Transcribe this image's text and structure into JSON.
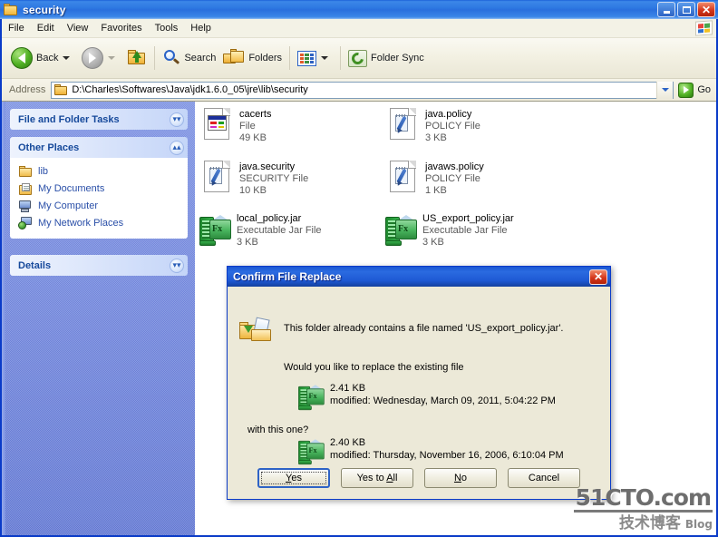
{
  "window": {
    "title": "security",
    "icon": "folder-icon",
    "buttons": {
      "minimize": "minimize",
      "maximize": "maximize",
      "close": "close"
    }
  },
  "menubar": {
    "items": [
      "File",
      "Edit",
      "View",
      "Favorites",
      "Tools",
      "Help"
    ],
    "logo": "windows-flag-icon"
  },
  "toolbar": {
    "back_label": "Back",
    "forward_label": "",
    "up_label": "",
    "search_label": "Search",
    "folders_label": "Folders",
    "views_label": "",
    "folder_sync_label": "Folder Sync"
  },
  "address": {
    "label": "Address",
    "path": "D:\\Charles\\Softwares\\Java\\jdk1.6.0_05\\jre\\lib\\security",
    "go_label": "Go"
  },
  "sidebar": {
    "panels": [
      {
        "title": "File and Folder Tasks",
        "state": "collapsed",
        "chevron": "chevron-down-icon"
      },
      {
        "title": "Other Places",
        "state": "expanded",
        "chevron": "chevron-up-icon"
      },
      {
        "title": "Details",
        "state": "collapsed",
        "chevron": "chevron-down-icon"
      }
    ],
    "other_places": [
      {
        "label": "lib",
        "icon": "folder-icon"
      },
      {
        "label": "My Documents",
        "icon": "my-documents-icon"
      },
      {
        "label": "My Computer",
        "icon": "my-computer-icon"
      },
      {
        "label": "My Network Places",
        "icon": "my-network-places-icon"
      }
    ]
  },
  "files": [
    {
      "name": "cacerts",
      "type": "File",
      "size": "49 KB",
      "icon": "generic-file-icon"
    },
    {
      "name": "java.policy",
      "type": "POLICY File",
      "size": "3 KB",
      "icon": "policy-file-icon"
    },
    {
      "name": "java.security",
      "type": "SECURITY File",
      "size": "10 KB",
      "icon": "security-file-icon"
    },
    {
      "name": "javaws.policy",
      "type": "POLICY File",
      "size": "1 KB",
      "icon": "policy-file-icon"
    },
    {
      "name": "local_policy.jar",
      "type": "Executable Jar File",
      "size": "3 KB",
      "icon": "jar-file-icon"
    },
    {
      "name": "US_export_policy.jar",
      "type": "Executable Jar File",
      "size": "3 KB",
      "icon": "jar-file-icon"
    }
  ],
  "dialog": {
    "title": "Confirm File Replace",
    "icon": "folder-replace-icon",
    "close_label": "✕",
    "line1": "This folder already contains a file named 'US_export_policy.jar'.",
    "line2": "Would you like to replace the existing file",
    "line3": "with this one?",
    "existing": {
      "size": "2.41 KB",
      "modified": "modified: Wednesday, March 09, 2011, 5:04:22 PM",
      "icon": "jar-file-icon"
    },
    "replacement": {
      "size": "2.40 KB",
      "modified": "modified: Thursday, November 16, 2006, 6:10:04 PM",
      "icon": "jar-file-icon"
    },
    "buttons": [
      {
        "label": "Yes",
        "accel": "Y",
        "default": true
      },
      {
        "label": "Yes to All",
        "accel": "A",
        "default": false
      },
      {
        "label": "No",
        "accel": "N",
        "default": false
      },
      {
        "label": "Cancel",
        "accel": "",
        "default": false
      }
    ]
  },
  "watermark": {
    "top": "51CTO.com",
    "bottom": "技术博客",
    "blog": "Blog"
  },
  "colors": {
    "titlebar_blue": "#2A6FDD",
    "sidebar_blue": "#6A81D8",
    "dialog_face": "#ECE9D8",
    "close_red": "#D4371C",
    "link_blue": "#2A4FA8"
  }
}
